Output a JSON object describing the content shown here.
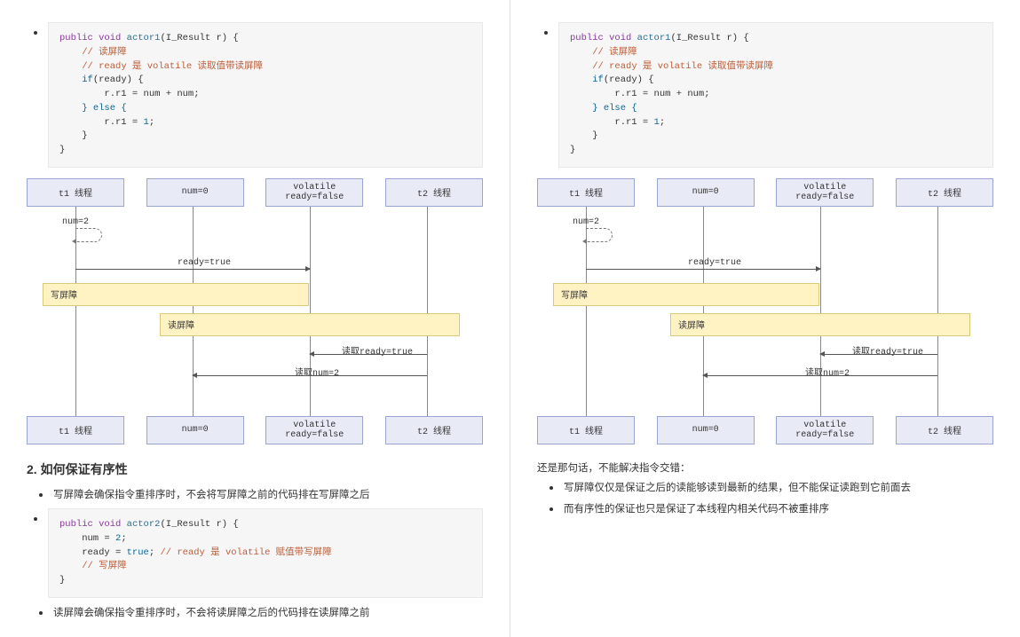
{
  "code": {
    "actor1": {
      "l1_public": "public",
      "l1_void": "void",
      "l1_fn": "actor1",
      "l1_rest": "(I_Result r) {",
      "l2": "// 读屏障",
      "l3": "// ready 是 volatile 读取值带读屏障",
      "l4_if": "if",
      "l4_rest": "(ready) {",
      "l5": "        r.r1 = num + num;",
      "l6_else": "} else {",
      "l7_a": "        r.r1 = ",
      "l7_num": "1",
      "l7_b": ";",
      "l8": "    }",
      "l9": "}"
    },
    "actor2": {
      "l1_public": "public",
      "l1_void": "void",
      "l1_fn": "actor2",
      "l1_rest": "(I_Result r) {",
      "l2_a": "    num = ",
      "l2_num": "2",
      "l2_b": ";",
      "l3_a": "    ready = ",
      "l3_true": "true",
      "l3_b": "; ",
      "l3_c": "// ready 是 volatile 赋值带写屏障",
      "l4": "// 写屏障",
      "l5": "}"
    }
  },
  "seq": {
    "lanes": [
      "t1 线程",
      "num=0",
      "volatile ready=false",
      "t2 线程"
    ],
    "msg_num2": "num=2",
    "msg_ready": "ready=true",
    "note_write": "写屏障",
    "note_read": "读屏障",
    "msg_read_ready": "读取ready=true",
    "msg_read_num": "读取num=2"
  },
  "left": {
    "heading": "2. 如何保证有序性",
    "b1": "写屏障会确保指令重排序时，不会将写屏障之前的代码排在写屏障之后",
    "b2": "读屏障会确保指令重排序时，不会将读屏障之后的代码排在读屏障之前"
  },
  "right": {
    "intro": "还是那句话，不能解决指令交错：",
    "b1": "写屏障仅仅是保证之后的读能够读到最新的结果，但不能保证读跑到它前面去",
    "b2": "而有序性的保证也只是保证了本线程内相关代码不被重排序"
  }
}
